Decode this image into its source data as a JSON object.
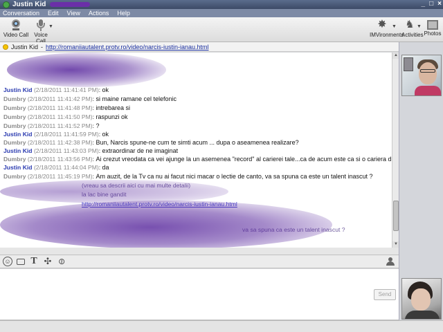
{
  "window": {
    "title": "Justin Kid",
    "controls": [
      "_",
      "□",
      "×"
    ]
  },
  "menu": [
    "Conversation",
    "Edit",
    "View",
    "Actions",
    "Help"
  ],
  "toolbar": {
    "video_call": "Video Call",
    "voice_call": "Voice Call",
    "imvironments": "IMVironments",
    "activities": "Activities",
    "photos": "Photos"
  },
  "address": {
    "name": "Justin Kid",
    "url": "http://romaniiautalent.protv.ro/video/narcis-iustin-ianau.html"
  },
  "chat": {
    "messages": [
      {
        "sender": "Justin Kid",
        "time": "(2/18/2011 11:41:41 PM)",
        "text": "ok"
      },
      {
        "sender": "Dumbry",
        "time": "(2/18/2011 11:41:42 PM)",
        "text": "si maine ramane cel telefonic"
      },
      {
        "sender": "Dumbry",
        "time": "(2/18/2011 11:41:48 PM)",
        "text": "intrebarea si"
      },
      {
        "sender": "Dumbry",
        "time": "(2/18/2011 11:41:50 PM)",
        "text": "raspunzi ok"
      },
      {
        "sender": "Dumbry",
        "time": "(2/18/2011 11:41:52 PM)",
        "text": "?"
      },
      {
        "sender": "Justin Kid",
        "time": "(2/18/2011 11:41:59 PM)",
        "text": "ok"
      },
      {
        "sender": "Dumbry",
        "time": "(2/18/2011 11:42:38 PM)",
        "text": "Bun, Narcis spune-ne cum te simti acum ... dupa o aseamenea realizare?"
      },
      {
        "sender": "Justin Kid",
        "time": "(2/18/2011 11:43:03 PM)",
        "text": "extraordinar de ne imaginat"
      },
      {
        "sender": "Dumbry",
        "time": "(2/18/2011 11:43:56 PM)",
        "text": "Ai crezut vreodata ca vei ajunge la un asemenea \"record\" al carierei  tale...ca de acum este ca si o cariera de viitor?"
      },
      {
        "sender": "Justin Kid",
        "time": "(2/18/2011 11:44:04 PM)",
        "text": "da"
      },
      {
        "sender": "Dumbry",
        "time": "(2/18/2011 11:45:19 PM)",
        "text": "Am auzit, de la Tv ca nu ai facut nici macar o lectie de canto, va sa spuna ca este un talent inascut ?"
      }
    ],
    "obscured_fragments": [
      "(vreau sa descrii aici cu mai multe detalii)",
      "la lac bine gandit",
      "http://romaniiautalent.protv.ro/video/narcis-iustin-ianau.html",
      "va sa spuna ca este un talent inascut ?"
    ]
  },
  "send_label": "Send",
  "colors": {
    "justin": "#2b3bb0",
    "dumbry": "#8a8a8a",
    "scribble": "#5a2a9e",
    "link": "#1a2fa0"
  },
  "icons": [
    "video-camera-icon",
    "microphone-icon",
    "imvironments-icon",
    "activities-icon",
    "photos-icon",
    "emoticon-icon",
    "bubble-icon",
    "text-format-icon",
    "audibles-icon",
    "attach-icon",
    "buddy-info-icon"
  ]
}
